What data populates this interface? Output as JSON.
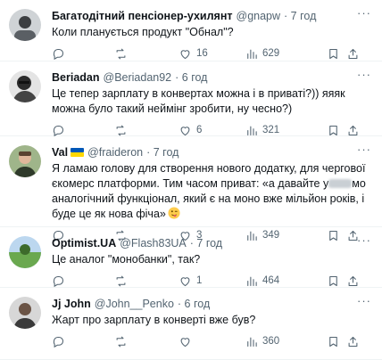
{
  "replies": [
    {
      "name": "Багатодітний пенсіонер-ухилянт",
      "handle": "@gnapw",
      "time": "· 7 год",
      "text": "Коли планується продукт \"Обнал\"?",
      "likes": "16",
      "views": "629"
    },
    {
      "name": "Beriadan",
      "handle": "@Beriadan92",
      "time": "· 6 год",
      "text": "Це тепер зарплату в конвертах можна і в приваті?)) яяяк можна було такий неймінг зробити, ну чесно?)",
      "likes": "6",
      "views": "321"
    },
    {
      "name": "Val",
      "handle": "@fraideron",
      "time": "· 7 год",
      "text_before": "Я ламаю голову для створення нового додатку, для чергової єкомерс платформи. Тим часом приват: «а давайте у",
      "text_after": "мо аналогічний функціонал, який є на моно вже мільйон років, і буде це як нова фіча»",
      "likes": "3",
      "views": "349",
      "flag_colors": [
        "#0057b7",
        "#ffd700"
      ]
    },
    {
      "name": "Optimist.UA",
      "handle": "@Flash83UA",
      "time": "· 7 год",
      "text": "Це аналог \"монобанки\", так?",
      "likes": "1",
      "views": "464"
    },
    {
      "name": "Jj John",
      "handle": "@John__Penko",
      "time": "· 6 год",
      "text": "Жарт про зарплату в конверті вже був?",
      "likes": "",
      "views": "360"
    }
  ],
  "icons": {
    "reply": "reply-icon",
    "repost": "repost-icon",
    "like": "like-icon",
    "views": "views-icon",
    "bookmark": "bookmark-icon",
    "share": "share-icon",
    "more": "more-icon"
  },
  "colors": {
    "text": "#0f1419",
    "muted": "#536471",
    "divider": "#eff3f4"
  }
}
